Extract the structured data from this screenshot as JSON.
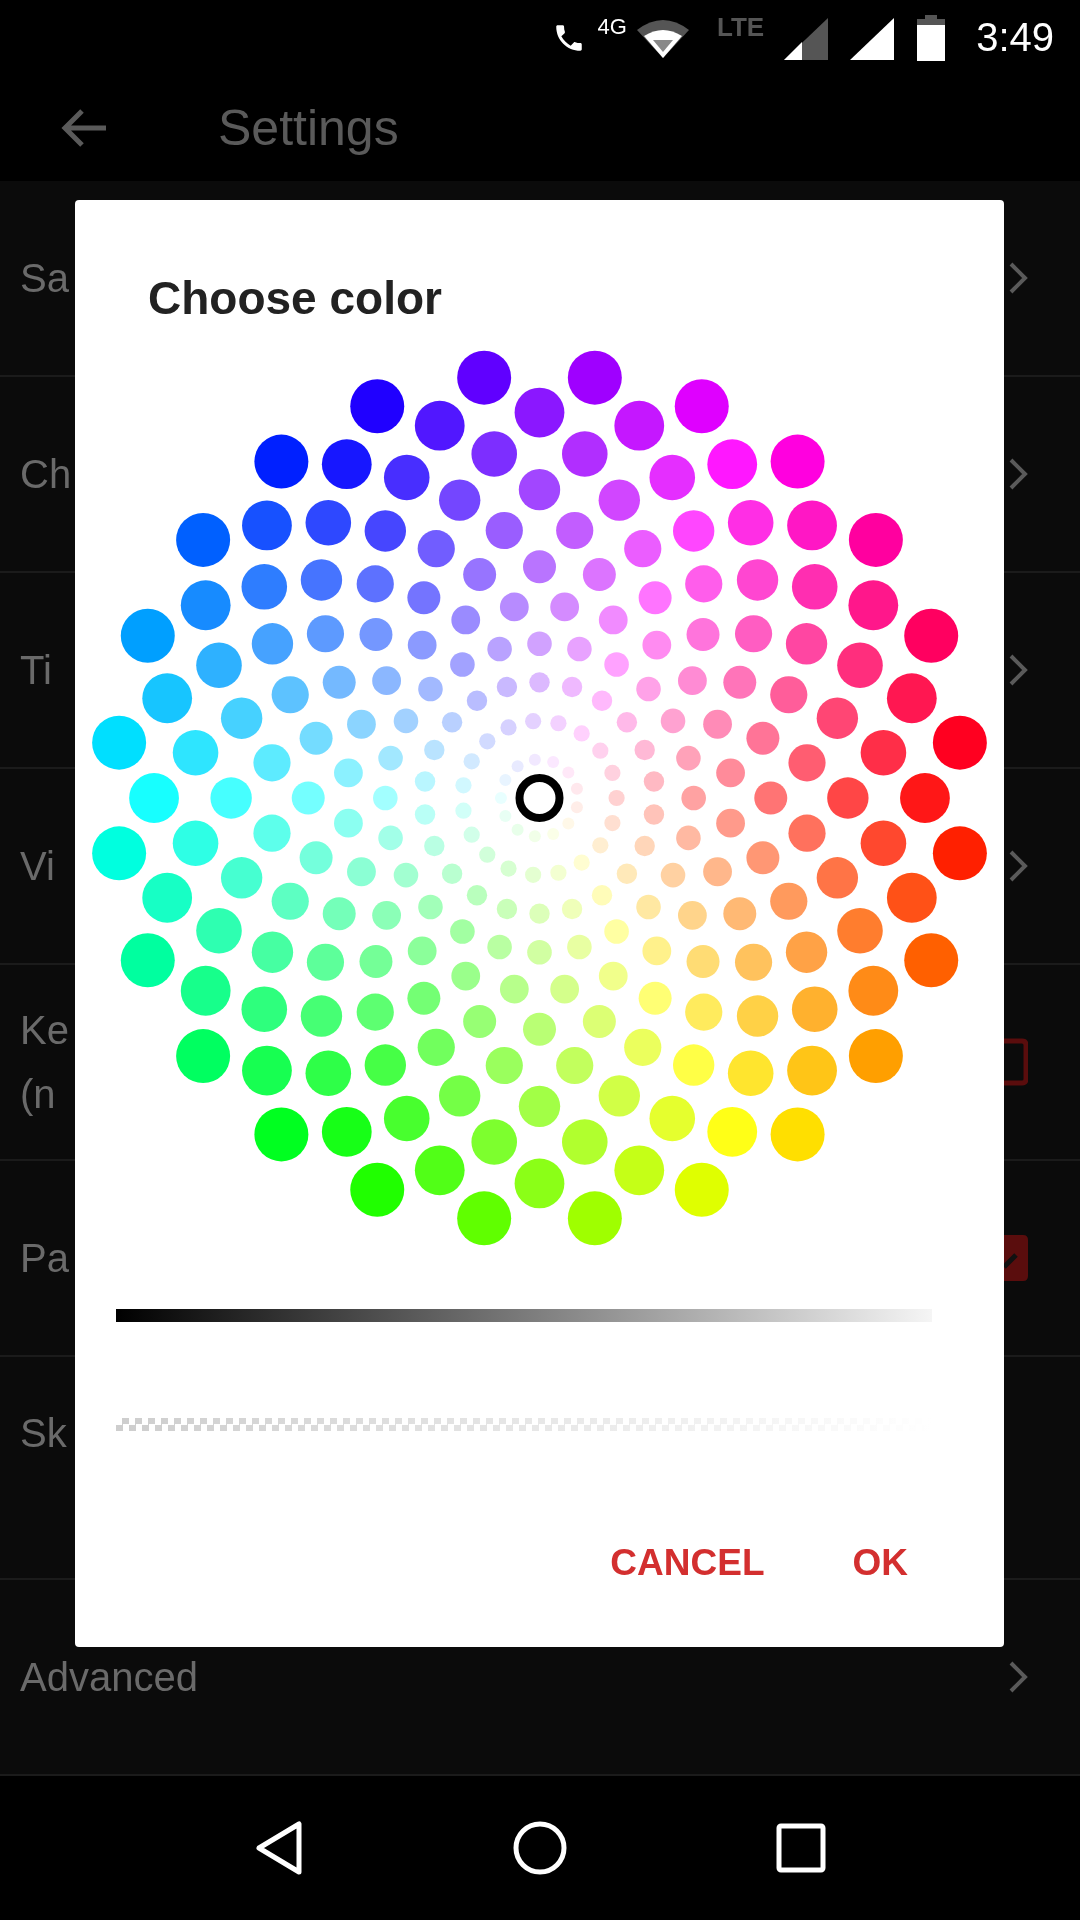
{
  "status_bar": {
    "call_badge": "4G",
    "network": "LTE",
    "time": "3:49"
  },
  "toolbar": {
    "title": "Settings"
  },
  "rows": [
    {
      "lines": [
        "Sa"
      ],
      "kind": "link"
    },
    {
      "lines": [
        "Ch"
      ],
      "kind": "link"
    },
    {
      "lines": [
        "Ti"
      ],
      "kind": "link"
    },
    {
      "lines": [
        "Vi"
      ],
      "kind": "link"
    },
    {
      "lines": [
        "Ke",
        "(n"
      ],
      "kind": "checkbox",
      "checked": false
    },
    {
      "lines": [
        "Pa"
      ],
      "kind": "checkbox",
      "checked": true
    },
    {
      "lines": [
        "Sk"
      ],
      "kind": "plain"
    },
    {
      "lines": [
        "Advanced"
      ],
      "kind": "link"
    }
  ],
  "dialog": {
    "title": "Choose color",
    "buttons": [
      "CANCEL",
      "OK"
    ]
  }
}
